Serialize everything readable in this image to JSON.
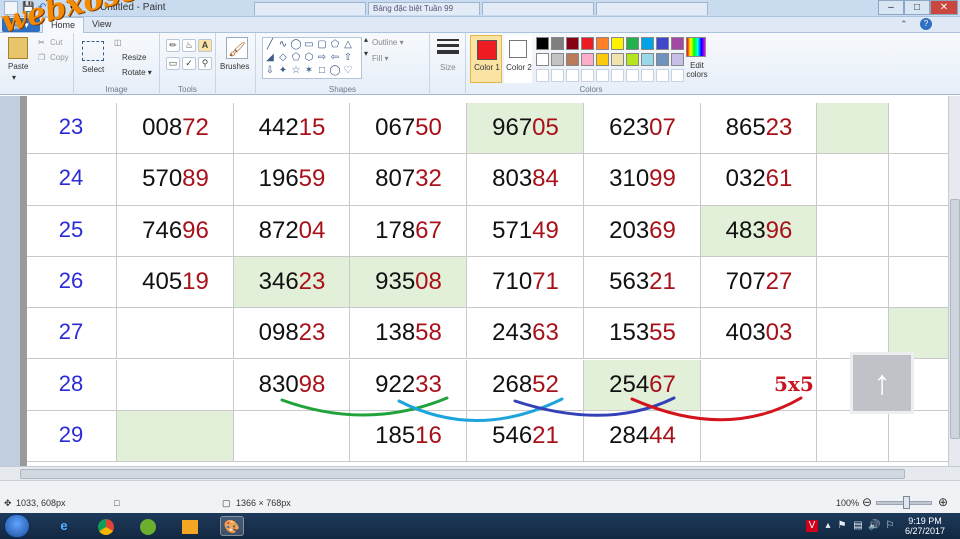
{
  "window": {
    "title": "Untitled - Paint",
    "browser_tabs": [
      "",
      "Bảng đặc biệt Tuần 99",
      "",
      ""
    ],
    "min_label": "–",
    "max_label": "□",
    "close_label": "✕"
  },
  "ribbon": {
    "file_label": "▤ ▾",
    "tabs": [
      "Home",
      "View"
    ],
    "clipboard": {
      "paste": "Paste",
      "cut": "Cut",
      "copy": "Copy"
    },
    "image": {
      "label": "Image",
      "resize": "Resize",
      "rotate": "Rotate ▾",
      "select": "Select"
    },
    "tools": {
      "label": "Tools"
    },
    "brushes": "Brushes",
    "shapes": {
      "label": "Shapes",
      "outline": "Outline ▾",
      "fill": "Fill ▾"
    },
    "size": "Size",
    "color1": "Color 1",
    "color2": "Color 2",
    "colors_label": "Colors",
    "edit_colors": "Edit colors",
    "color1_value": "#ed1c24",
    "color2_value": "#ffffff",
    "palette": [
      "#000000",
      "#7f7f7f",
      "#880015",
      "#ed1c24",
      "#ff7f27",
      "#fff200",
      "#22b14c",
      "#00a2e8",
      "#3f48cc",
      "#a349a4",
      "#ffffff",
      "#c3c3c3",
      "#b97a57",
      "#ffaec9",
      "#ffc90e",
      "#efe4b0",
      "#b5e61d",
      "#99d9ea",
      "#7092be",
      "#c8bfe7"
    ]
  },
  "watermark": "webxoso.net",
  "grid": {
    "rows": [
      {
        "label": "23",
        "cells": [
          [
            "008",
            "72"
          ],
          [
            "442",
            "15"
          ],
          [
            "067",
            "50"
          ],
          [
            "967",
            "05"
          ],
          [
            "623",
            "07"
          ],
          [
            "865",
            "23"
          ],
          [
            "",
            ""
          ],
          [
            "",
            ""
          ]
        ],
        "green": [
          3,
          6
        ]
      },
      {
        "label": "24",
        "cells": [
          [
            "570",
            "89"
          ],
          [
            "196",
            "59"
          ],
          [
            "807",
            "32"
          ],
          [
            "803",
            "84"
          ],
          [
            "310",
            "99"
          ],
          [
            "032",
            "61"
          ],
          [
            "",
            ""
          ],
          [
            "",
            ""
          ]
        ],
        "green": []
      },
      {
        "label": "25",
        "cells": [
          [
            "746",
            "96"
          ],
          [
            "872",
            "04"
          ],
          [
            "178",
            "67"
          ],
          [
            "571",
            "49"
          ],
          [
            "203",
            "69"
          ],
          [
            "483",
            "96"
          ],
          [
            "",
            ""
          ],
          [
            "",
            ""
          ]
        ],
        "green": [
          5
        ]
      },
      {
        "label": "26",
        "cells": [
          [
            "405",
            "19"
          ],
          [
            "346",
            "23"
          ],
          [
            "935",
            "08"
          ],
          [
            "710",
            "71"
          ],
          [
            "563",
            "21"
          ],
          [
            "707",
            "27"
          ],
          [
            "",
            ""
          ],
          [
            "",
            ""
          ]
        ],
        "green": [
          1,
          2
        ]
      },
      {
        "label": "27",
        "cells": [
          [
            "",
            ""
          ],
          [
            "098",
            "23"
          ],
          [
            "138",
            "58"
          ],
          [
            "243",
            "63"
          ],
          [
            "153",
            "55"
          ],
          [
            "403",
            "03"
          ],
          [
            "",
            ""
          ],
          [
            "",
            ""
          ]
        ],
        "green": [
          7
        ]
      },
      {
        "label": "28",
        "cells": [
          [
            "",
            ""
          ],
          [
            "830",
            "98"
          ],
          [
            "922",
            "33"
          ],
          [
            "268",
            "52"
          ],
          [
            "254",
            "67"
          ],
          [
            "",
            ""
          ],
          [
            "",
            ""
          ],
          [
            "",
            ""
          ]
        ],
        "green": [
          4
        ]
      },
      {
        "label": "29",
        "cells": [
          [
            "",
            ""
          ],
          [
            "",
            ""
          ],
          [
            "185",
            "16"
          ],
          [
            "546",
            "21"
          ],
          [
            "284",
            "44"
          ],
          [
            "",
            ""
          ],
          [
            "",
            ""
          ],
          [
            "",
            ""
          ]
        ],
        "green": [
          0
        ]
      }
    ],
    "annotation": "5x5",
    "annotation_color": "#c8141e",
    "curve_colors": [
      "#1fa33a",
      "#1ea4dc",
      "#3340b8",
      "#d4141c"
    ]
  },
  "statusbar": {
    "cursor_pos": "1033, 608px",
    "image_size": "1366 × 768px",
    "zoom": "100%",
    "zoom_out": "⊖",
    "zoom_in": "⊕"
  },
  "taskbar": {
    "time": "9:19 PM",
    "date": "6/27/2017"
  },
  "up_button": "↑"
}
